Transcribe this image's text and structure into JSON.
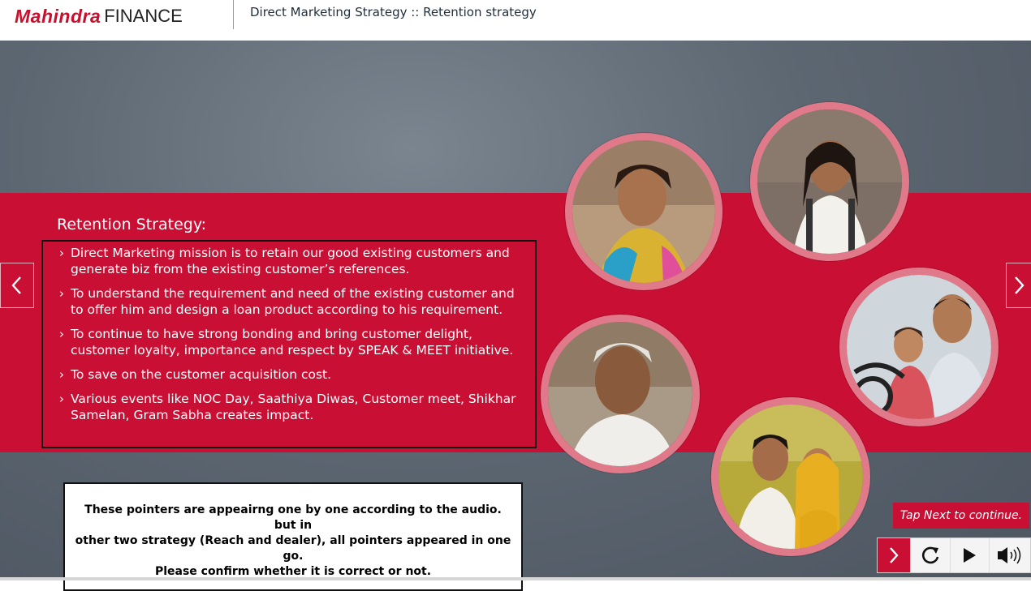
{
  "header": {
    "logo_brand": "Mahindra",
    "logo_suffix": "FINANCE",
    "title": "Direct Marketing Strategy :: Retention strategy"
  },
  "slide": {
    "section_title": "Retention Strategy:",
    "points": [
      "Direct Marketing mission is to retain our good existing customers and generate biz from the existing customer’s references.",
      "To understand the requirement and need of the existing customer and to offer him and design a loan product according to his requirement.",
      "To continue to have strong bonding and bring customer delight, customer loyalty, importance and respect by SPEAK & MEET initiative.",
      "To save on the customer acquisition cost.",
      "Various events like NOC Day, Saathiya Diwas, Customer meet, Shikhar Samelan, Gram Sabha creates impact."
    ],
    "bullet_icon": "chevron-right-icon"
  },
  "note": {
    "text_line1": "These pointers are appeairng one by one according to the audio. but in",
    "text_line2": "other two strategy (Reach and dealer), all pointers appeared in one go.",
    "text_line3": "Please confirm whether it is correct or not."
  },
  "prompt": {
    "tap_next": "Tap Next to continue."
  },
  "controls": {
    "next_icon": "chevron-right-icon",
    "replay_icon": "replay-icon",
    "play_icon": "play-icon",
    "audio_icon": "speaker-icon"
  },
  "colors": {
    "brand_red": "#c90f33",
    "background_gray": "#5d6772",
    "photo_ring": "#e07a8a"
  }
}
